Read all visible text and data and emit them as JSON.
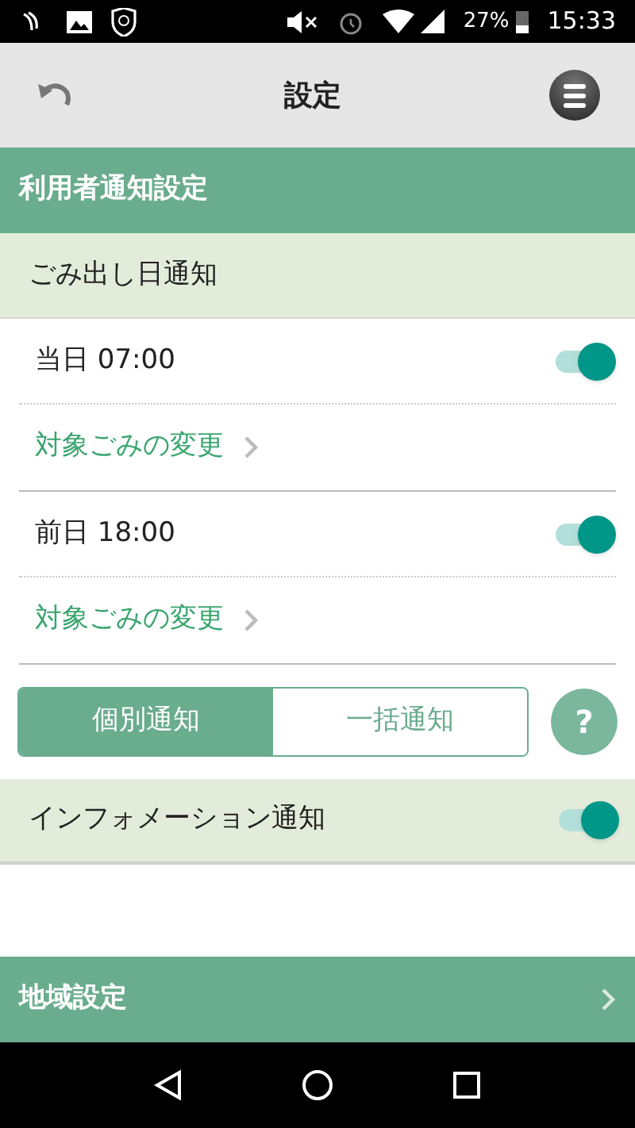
{
  "status_bar": {
    "battery": "27%",
    "time": "15:33"
  },
  "header": {
    "title": "設定"
  },
  "section": {
    "title": "利用者通知設定"
  },
  "subsection": {
    "title": "ごみ出し日通知"
  },
  "notifications": [
    {
      "label": "当日 07:00",
      "on": true,
      "link": "対象ごみの変更"
    },
    {
      "label": "前日 18:00",
      "on": true,
      "link": "対象ごみの変更"
    }
  ],
  "segments": [
    {
      "label": "個別通知",
      "selected": true
    },
    {
      "label": "一括通知",
      "selected": false
    }
  ],
  "help": "?",
  "info": {
    "label": "インフォメーション通知",
    "on": true
  },
  "region": {
    "title": "地域設定"
  }
}
